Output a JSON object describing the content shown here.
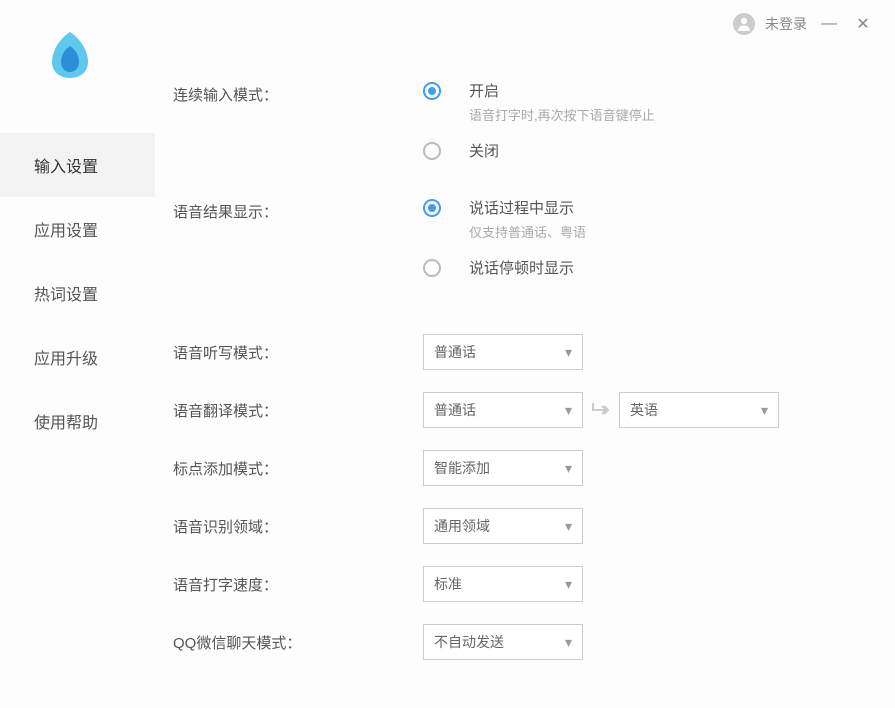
{
  "titlebar": {
    "login_status": "未登录"
  },
  "sidebar": {
    "items": [
      {
        "label": "输入设置",
        "active": true
      },
      {
        "label": "应用设置",
        "active": false
      },
      {
        "label": "热词设置",
        "active": false
      },
      {
        "label": "应用升级",
        "active": false
      },
      {
        "label": "使用帮助",
        "active": false
      }
    ]
  },
  "settings": {
    "continuous_input": {
      "label": "连续输入模式：",
      "option_on": "开启",
      "option_on_desc": "语音打字时,再次按下语音键停止",
      "option_off": "关闭"
    },
    "voice_result": {
      "label": "语音结果显示：",
      "option_during": "说话过程中显示",
      "option_during_desc": "仅支持普通话、粤语",
      "option_pause": "说话停顿时显示"
    },
    "dictation_mode": {
      "label": "语音听写模式：",
      "value": "普通话"
    },
    "translation_mode": {
      "label": "语音翻译模式：",
      "from": "普通话",
      "to": "英语"
    },
    "punctuation_mode": {
      "label": "标点添加模式：",
      "value": "智能添加"
    },
    "recognition_domain": {
      "label": "语音识别领域：",
      "value": "通用领域"
    },
    "typing_speed": {
      "label": "语音打字速度：",
      "value": "标准"
    },
    "chat_mode": {
      "label": "QQ微信聊天模式：",
      "value": "不自动发送"
    }
  }
}
